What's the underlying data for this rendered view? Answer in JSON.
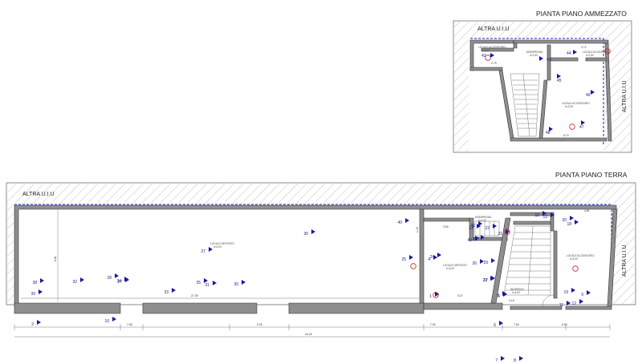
{
  "plans": {
    "mezzanine": {
      "title": "PIANTA PIANO AMMEZZATO",
      "neighbor_top": "ALTRA U.I.U",
      "neighbor_side": "ALTRA U.I.U",
      "rooms": [
        {
          "name": "DISIMPEGNO",
          "sub": "h=2,50",
          "marker": "1"
        },
        {
          "name": "LOCALE ACCESSORIO",
          "sub": "h=2,50",
          "marker": "2"
        },
        {
          "name": "LOCALE ACCESSORIO",
          "sub": "h=2,50",
          "marker": "3"
        },
        {
          "name": "LOCALE ACCESSORIO",
          "sub": "h=2,50",
          "marker": "4"
        }
      ],
      "dimensions": [
        "2.75",
        "3.71",
        "6.74"
      ],
      "photo_points": [
        "43",
        "44",
        "45",
        "46",
        "47",
        "48"
      ]
    },
    "ground": {
      "title": "PIANTA PIANO TERRA",
      "neighbor_top": "ALTRA U.I.U",
      "neighbor_side": "ALTRA U.I.U",
      "rooms": [
        {
          "name": "LOCALE DEPOSITO",
          "sub": "h=5,00"
        },
        {
          "name": "LOCALE DEPOSITO",
          "sub": "h=4,00"
        },
        {
          "name": "DISIMPEGNO",
          "sub": "h=4,00"
        },
        {
          "name": "LOCALE ACCESSORIO",
          "sub": "h=4,00"
        },
        {
          "name": "INGRESSO",
          "sub": "h=4,00"
        }
      ],
      "dimensions": {
        "left_height": "6.81",
        "main_width": "27.39",
        "mid_width": "5.27",
        "room_top": "3.90",
        "right_width": "4.81",
        "bottom_a": "7.65",
        "bottom_b": "5.25",
        "bottom_total": "44.18",
        "bottom_c": "7.90",
        "bottom_d": "7.60",
        "bottom_e": "5.00",
        "small_a": "1.18",
        "small_b": "2.15"
      },
      "photo_points": [
        "1",
        "2",
        "3",
        "4",
        "5",
        "6",
        "7",
        "8",
        "9",
        "10",
        "11",
        "12",
        "13",
        "14",
        "15",
        "16",
        "17",
        "18",
        "19",
        "20",
        "21",
        "22",
        "23",
        "24",
        "25",
        "26",
        "27",
        "28",
        "29",
        "30",
        "31",
        "32",
        "33",
        "34",
        "35",
        "36",
        "37",
        "38",
        "39",
        "40",
        "41",
        "42"
      ]
    }
  }
}
